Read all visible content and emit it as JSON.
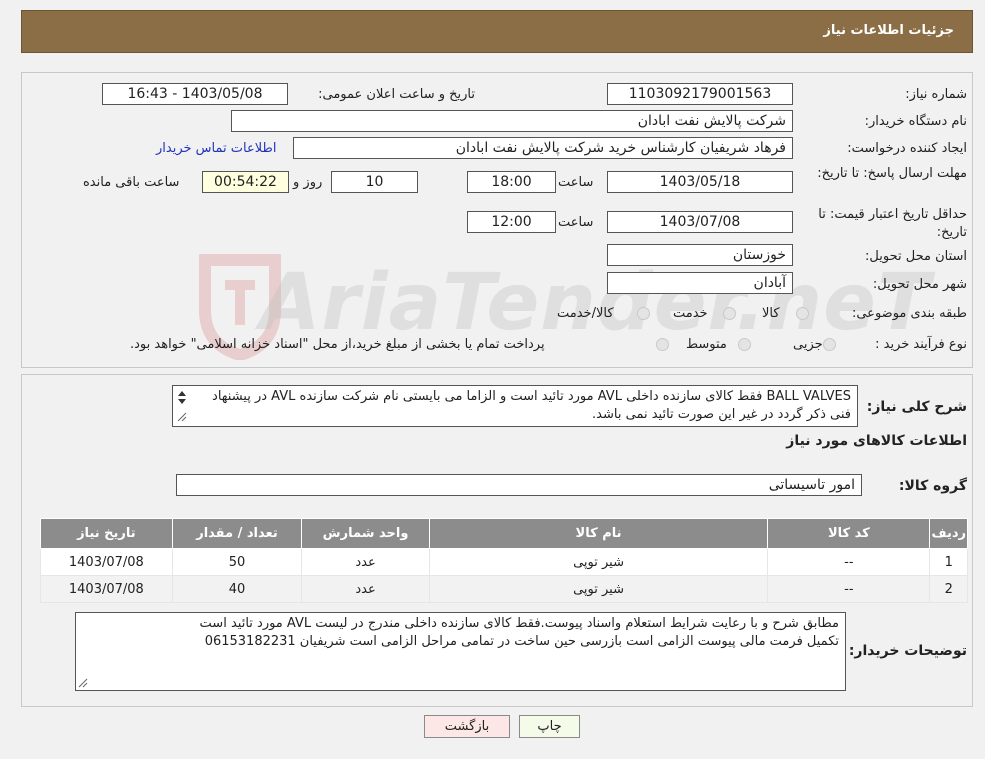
{
  "header": {
    "title": "جزئیات اطلاعات نیاز"
  },
  "fields": {
    "need_number_label": "شماره نیاز:",
    "need_number": "1103092179001563",
    "announce_label": "تاریخ و ساعت اعلان عمومی:",
    "announce_value": "1403/05/08 - 16:43",
    "buyer_org_label": "نام دستگاه خریدار:",
    "buyer_org": "شرکت پالایش نفت ابادان",
    "creator_label": "ایجاد کننده درخواست:",
    "creator": "فرهاد شریفیان کارشناس خرید شرکت پالایش نفت ابادان",
    "contact_link": "اطلاعات تماس خریدار",
    "deadline_label": "مهلت ارسال پاسخ: تا تاریخ:",
    "deadline_date": "1403/05/18",
    "time_label": "ساعت",
    "deadline_time": "18:00",
    "days_value": "10",
    "days_label": "روز و",
    "remaining_time": "00:54:22",
    "remaining_label": "ساعت باقی مانده",
    "price_valid_label": "حداقل تاریخ اعتبار قیمت: تا تاریخ:",
    "price_valid_date": "1403/07/08",
    "price_valid_time": "12:00",
    "province_label": "استان محل تحویل:",
    "province": "خوزستان",
    "city_label": "شهر محل تحویل:",
    "city": "آبادان",
    "category_label": "طبقه بندی موضوعی:",
    "category_options": [
      "کالا",
      "خدمت",
      "کالا/خدمت"
    ],
    "process_label": "نوع فرآیند خرید :",
    "process_options": [
      "جزیی",
      "متوسط"
    ],
    "payment_note": "پرداخت تمام یا بخشی از مبلغ خرید،از محل \"اسناد خزانه اسلامی\" خواهد بود."
  },
  "description": {
    "label": "شرح کلی نیاز:",
    "text": "BALL VALVES فقط کالای سازنده داخلی AVL مورد تائید است و الزاما می بایستی نام شرکت سازنده AVL در پیشنهاد فنی ذکر گردد در غیر این صورت تائید نمی باشد.",
    "goods_info_title": "اطلاعات کالاهای مورد نیاز",
    "group_label": "گروه کالا:",
    "group_value": "امور تاسیساتی"
  },
  "table": {
    "columns": [
      "ردیف",
      "کد کالا",
      "نام کالا",
      "واحد شمارش",
      "تعداد / مقدار",
      "تاریخ نیاز"
    ],
    "rows": [
      [
        "1",
        "--",
        "شیر توپی",
        "عدد",
        "50",
        "1403/07/08"
      ],
      [
        "2",
        "--",
        "شیر توپی",
        "عدد",
        "40",
        "1403/07/08"
      ]
    ]
  },
  "buyer_notes": {
    "label": "توضیحات خریدار:",
    "line1": "مطابق شرح و با رعایت شرایط استعلام واسناد پیوست.فقط کالای سازنده داخلی مندرج در لیست AVL مورد تائید است",
    "line2": "تکمیل فرمت مالی پیوست الزامی است بازرسی حین ساخت در تمامی مراحل الزامی  است شریفیان 06153182231"
  },
  "buttons": {
    "print": "چاپ",
    "back": "بازگشت"
  },
  "watermark": "AriaTender.neT",
  "colors": {
    "header_bg": "#8b6e46",
    "table_header": "#8c8c8c",
    "remaining_bg": "#ffffe0",
    "link": "#2233bb"
  }
}
